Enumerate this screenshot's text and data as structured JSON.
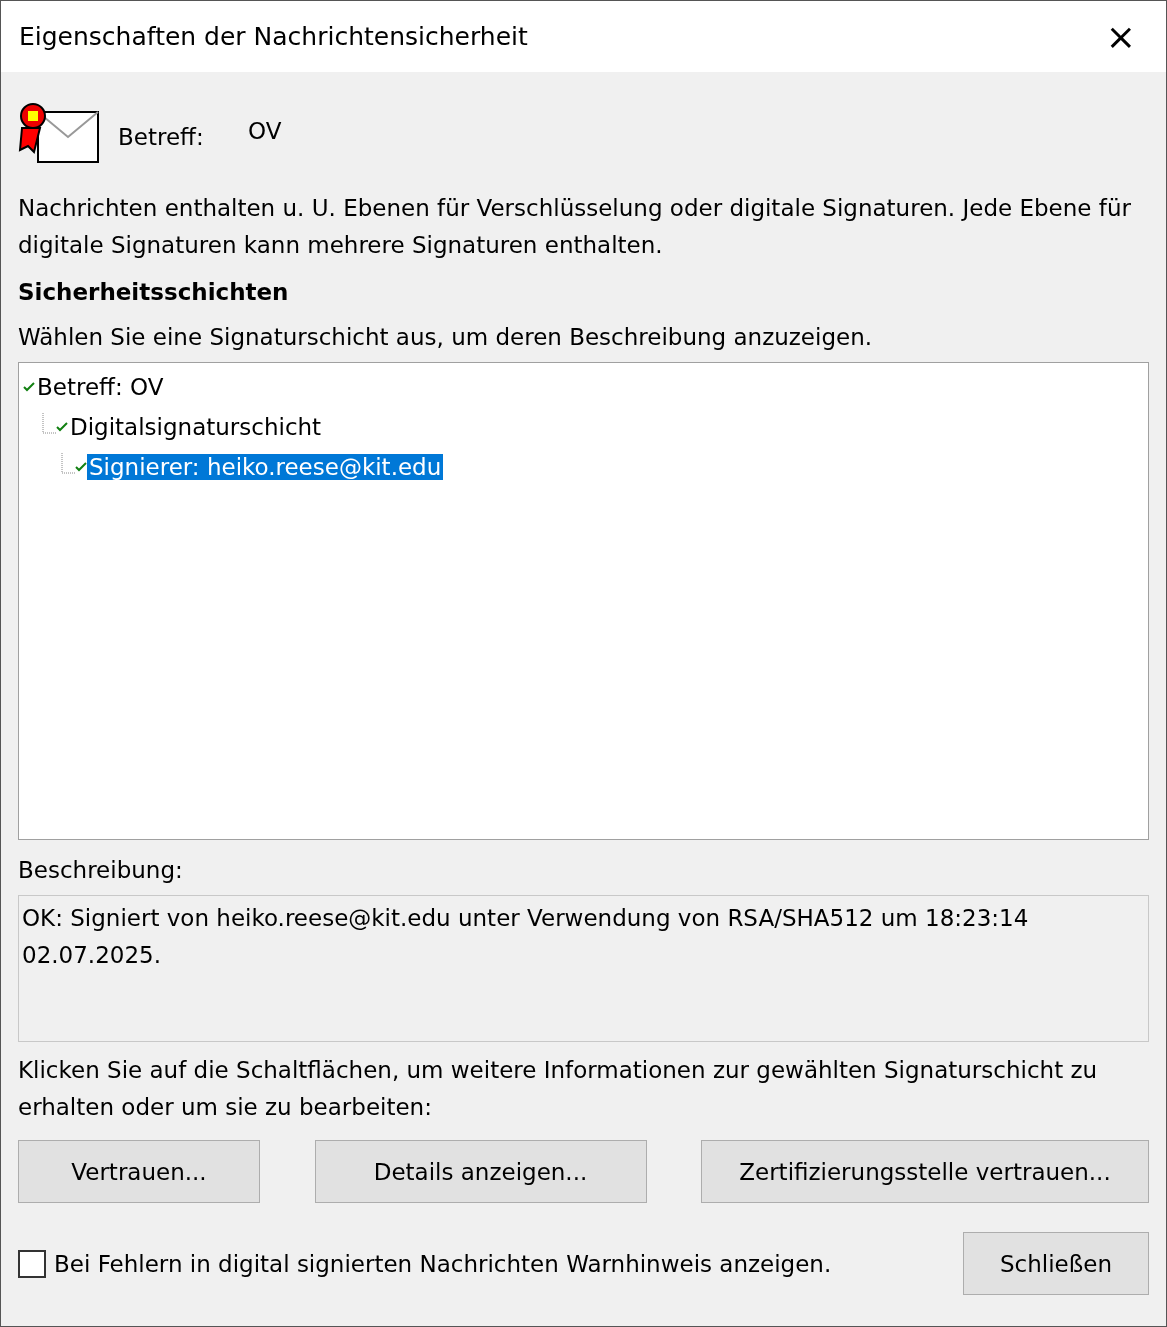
{
  "window": {
    "title": "Eigenschaften der Nachrichtensicherheit",
    "close": "×"
  },
  "header": {
    "subject_label": "Betreff:",
    "subject": "OV"
  },
  "intro": "Nachrichten enthalten u. U. Ebenen für Verschlüsselung oder digitale Signaturen. Jede Ebene für digitale Signaturen kann mehrere Signaturen enthalten.",
  "section_title": "Sicherheitsschichten",
  "section_hint": "Wählen Sie eine Signaturschicht aus, um deren Beschreibung anzuzeigen.",
  "tree": [
    {
      "label": "Betreff: OV",
      "selected": false,
      "children": [
        {
          "label": "Digitalsignaturschicht",
          "selected": false,
          "children": [
            {
              "label": "Signierer: heiko.reese@kit.edu",
              "selected": true
            }
          ]
        }
      ]
    }
  ],
  "description_label": "Beschreibung:",
  "description": "OK: Signiert von heiko.reese@kit.edu unter Verwendung von RSA/SHA512 um 18:23:14 02.07.2025.",
  "buttons_hint": "Klicken Sie auf die Schaltflächen, um weitere Informationen zur gewählten Signaturschicht zu erhalten oder um sie zu bearbeiten:",
  "buttons": [
    "Vertrauen...",
    "Details anzeigen...",
    "Zertifizierungsstelle vertrauen..."
  ],
  "warn_checkbox": {
    "label": "Bei Fehlern in digital signierten Nachrichten Warnhinweis anzeigen.",
    "checked": false
  },
  "close_button": "Schließen"
}
